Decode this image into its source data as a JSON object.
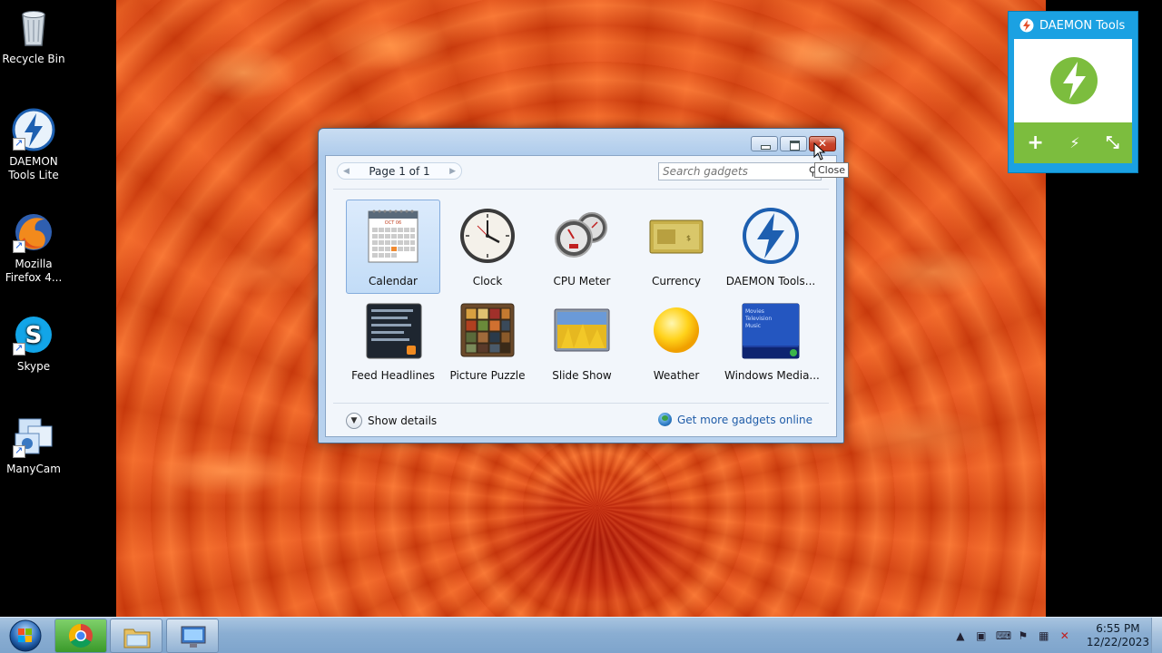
{
  "desktop": {
    "icons": [
      {
        "label_line1": "Recycle Bin",
        "label_line2": "",
        "icon": "recycle-bin-icon"
      },
      {
        "label_line1": "DAEMON",
        "label_line2": "Tools Lite",
        "icon": "daemon-tools-icon"
      },
      {
        "label_line1": "Mozilla",
        "label_line2": "Firefox 4...",
        "icon": "firefox-icon"
      },
      {
        "label_line1": "Skype",
        "label_line2": "",
        "icon": "skype-icon"
      },
      {
        "label_line1": "ManyCam",
        "label_line2": "",
        "icon": "manycam-icon"
      }
    ]
  },
  "gallery": {
    "pager_label": "Page 1 of 1",
    "search_placeholder": "Search gadgets",
    "tooltip": "Close",
    "gadgets": [
      {
        "label": "Calendar",
        "selected": true
      },
      {
        "label": "Clock"
      },
      {
        "label": "CPU Meter"
      },
      {
        "label": "Currency"
      },
      {
        "label": "DAEMON Tools..."
      },
      {
        "label": "Feed Headlines"
      },
      {
        "label": "Picture Puzzle"
      },
      {
        "label": "Slide Show"
      },
      {
        "label": "Weather"
      },
      {
        "label": "Windows Media..."
      }
    ],
    "calendar_month": "OCT 06",
    "media_center_lines": [
      "Movies",
      "Television",
      "Music"
    ],
    "show_details": "Show details",
    "get_more": "Get more gadgets online"
  },
  "daemon_gadget": {
    "title": "DAEMON Tools"
  },
  "taskbar": {
    "time": "6:55 PM",
    "date": "12/22/2023"
  },
  "colors": {
    "daemon_blue": "#1ba1e2",
    "daemon_green": "#7cbd3e",
    "link_blue": "#1f5ca8"
  }
}
